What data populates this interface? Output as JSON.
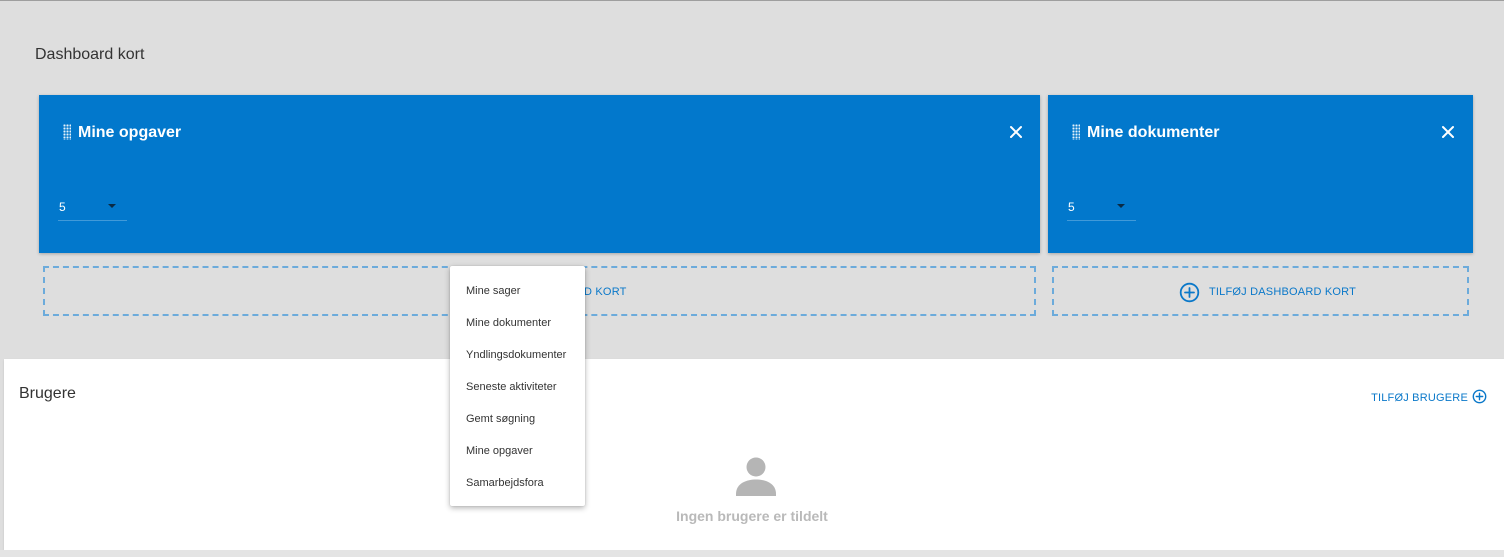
{
  "page": {
    "section_title": "Dashboard kort"
  },
  "cards": [
    {
      "title": "Mine opgaver",
      "count_value": "5",
      "close_icon": "close-icon",
      "drag_icon": "drag-handle-icon"
    },
    {
      "title": "Mine dokumenter",
      "count_value": "5",
      "close_icon": "close-icon",
      "drag_icon": "drag-handle-icon"
    }
  ],
  "dropzones": [
    {
      "label": "D KORT"
    },
    {
      "label": "TILFØJ DASHBOARD KORT",
      "icon": "add-circle-icon"
    }
  ],
  "menu": {
    "items": [
      "Mine sager",
      "Mine dokumenter",
      "Yndlingsdokumenter",
      "Seneste aktiviteter",
      "Gemt søgning",
      "Mine opgaver",
      "Samarbejdsfora"
    ]
  },
  "users": {
    "title": "Brugere",
    "add_label": "TILFØJ BRUGERE",
    "empty_text": "Ingen brugere er tildelt",
    "empty_icon": "person-icon"
  },
  "colors": {
    "card_bg": "#0278cc",
    "accent": "#0a78c9",
    "dropzone_border": "#6cabdb",
    "background": "#dedede"
  }
}
